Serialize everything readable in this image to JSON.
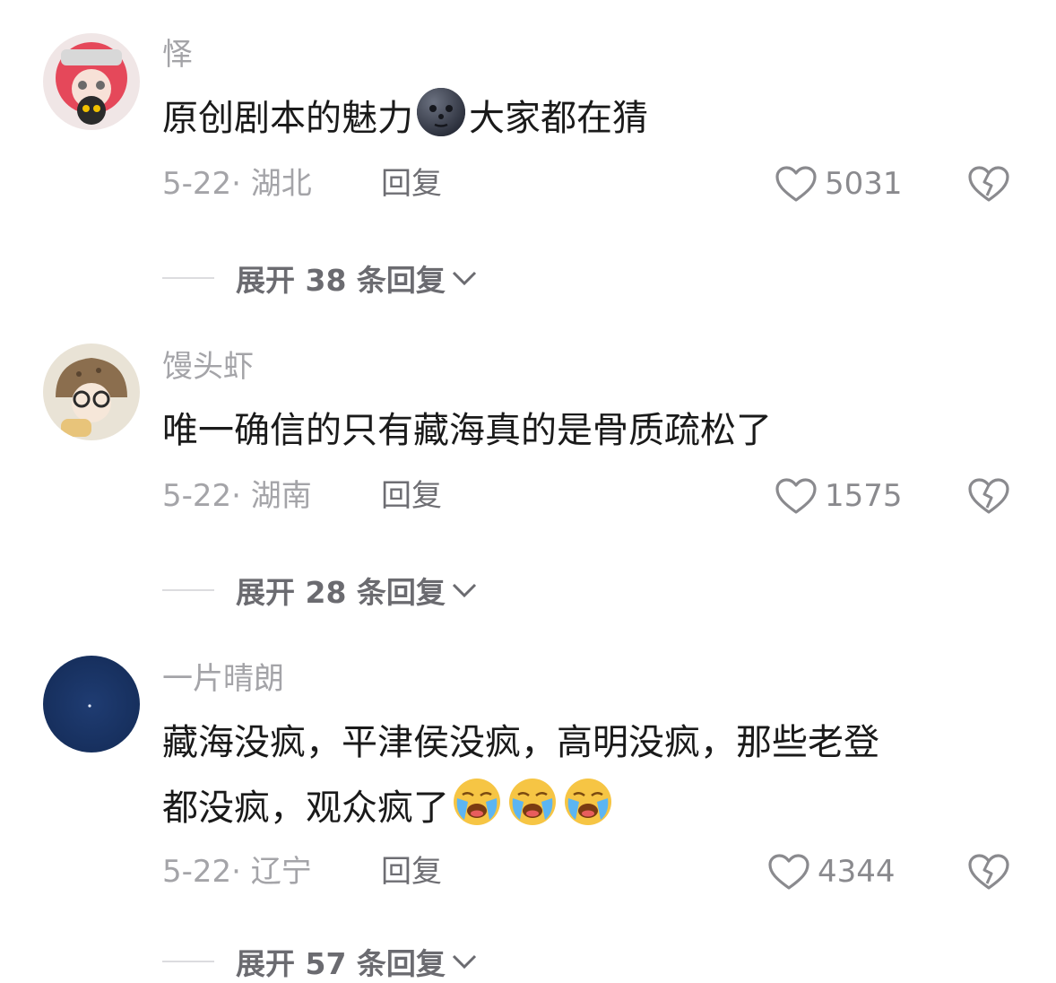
{
  "comments": [
    {
      "username": "怿",
      "text_before": "原创剧本的魅力",
      "text_after": "大家都在猜",
      "date_location": "5-22· 湖北",
      "reply_label": "回复",
      "likes": "5031",
      "expand_label": "展开 38 条回复",
      "emoji": "new-moon-face"
    },
    {
      "username": "馒头虾",
      "text": "唯一确信的只有藏海真的是骨质疏松了",
      "date_location": "5-22· 湖南",
      "reply_label": "回复",
      "likes": "1575",
      "expand_label": "展开 28 条回复"
    },
    {
      "username": "一片晴朗",
      "text_line1": "藏海没疯，平津侯没疯，高明没疯，那些老登",
      "text_line2": "都没疯，观众疯了",
      "date_location": "5-22· 辽宁",
      "reply_label": "回复",
      "likes": "4344",
      "expand_label": "展开 57 条回复",
      "emoji": "loudly-crying-face"
    }
  ],
  "colors": {
    "username": "#a4a4a8",
    "text": "#1a1a1a",
    "meta": "#a4a4a8",
    "reply": "#6e6e73"
  }
}
